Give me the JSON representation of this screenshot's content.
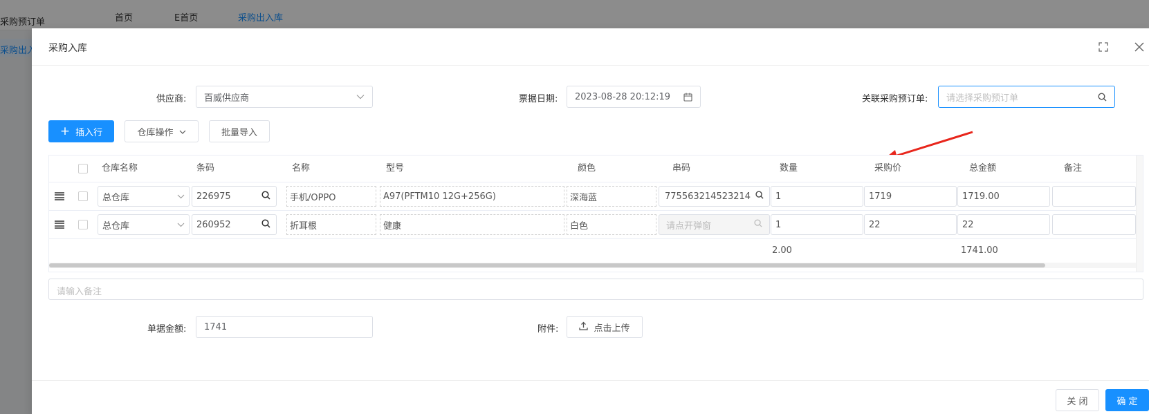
{
  "background": {
    "side_item_1": "采购预订单",
    "side_item_2": "采购出入",
    "tabs": [
      "首页",
      "E首页",
      "采购出入库"
    ]
  },
  "modal": {
    "title": "采购入库"
  },
  "form": {
    "supplier_label": "供应商:",
    "supplier_value": "百威供应商",
    "date_label": "票据日期:",
    "date_value": "2023-08-28 20:12:19",
    "preorder_label": "关联采购预订单:",
    "preorder_placeholder": "请选择采购预订单"
  },
  "toolbar": {
    "insert_label": "插入行",
    "warehouse_op_label": "仓库操作",
    "batch_import_label": "批量导入"
  },
  "table": {
    "headers": [
      "仓库名称",
      "条码",
      "名称",
      "型号",
      "颜色",
      "串码",
      "数量",
      "采购价",
      "总金额",
      "备注"
    ],
    "rows": [
      {
        "warehouse": "总仓库",
        "barcode": "226975",
        "name": "手机/OPPO",
        "model": "A97(PFTM10 12G+256G)",
        "color": "深海蓝",
        "serial": "775563214523214",
        "qty": "1",
        "price": "1719",
        "total": "1719.00"
      },
      {
        "warehouse": "总仓库",
        "barcode": "260952",
        "name": "折耳根",
        "model": "健康",
        "color": "白色",
        "serial_placeholder": "请点开弹窗",
        "qty": "1",
        "price": "22",
        "total": "22"
      }
    ],
    "sum_qty": "2.00",
    "sum_total": "1741.00"
  },
  "remark": {
    "placeholder": "请输入备注"
  },
  "bottom": {
    "amount_label": "单据金额:",
    "amount_value": "1741",
    "attach_label": "附件:",
    "upload_label": "点击上传"
  },
  "footer": {
    "close_label": "关 闭",
    "confirm_label": "确 定"
  },
  "colors": {
    "primary": "#1890ff",
    "annotation_arrow": "#e8261c"
  }
}
